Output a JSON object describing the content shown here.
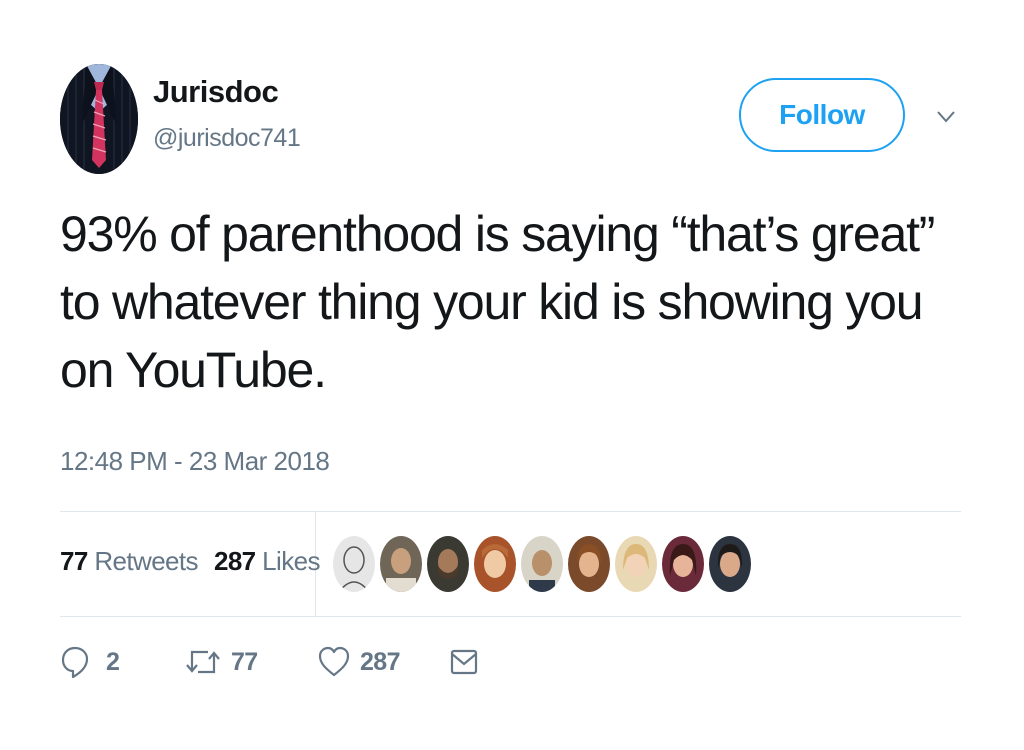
{
  "user": {
    "display_name": "Jurisdoc",
    "handle": "@jurisdoc741"
  },
  "follow_label": "Follow",
  "tweet": {
    "text": "93% of parenthood is saying “that’s great” to whatever thing your kid is showing you on YouTube.",
    "timestamp": "12:48 PM - 23 Mar 2018"
  },
  "stats": {
    "retweets_count": "77",
    "retweets_label": "Retweets",
    "likes_count": "287",
    "likes_label": "Likes"
  },
  "actions": {
    "reply_count": "2",
    "retweet_count": "77",
    "like_count": "287"
  },
  "colors": {
    "accent": "#1da1f2",
    "secondary_text": "#657786",
    "divider": "#e1e8ed"
  },
  "icons": [
    "chevron-down-icon",
    "reply-icon",
    "retweet-icon",
    "like-icon",
    "direct-message-icon"
  ]
}
